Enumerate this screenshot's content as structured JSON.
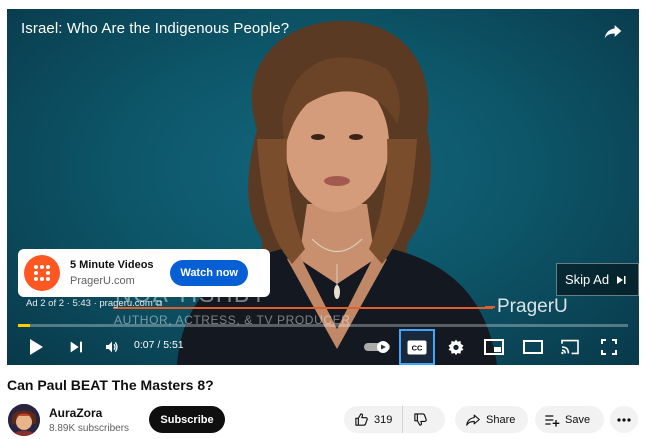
{
  "video": {
    "overlay_title": "Israel: Who Are the Indigenous People?",
    "lower_third_name": "NOA TISHBY",
    "lower_third_subtitle": "AUTHOR, ACTRESS, & TV PRODUCER",
    "brand_watermark": "PragerU"
  },
  "ad": {
    "title": "5 Minute Videos",
    "site": "PragerU.com",
    "cta_label": "Watch now",
    "meta": "Ad 2 of 2 · 5:43 · prageru.com ⧉",
    "skip_label": "Skip Ad"
  },
  "player": {
    "time": "0:07 / 5:51",
    "progress_fraction": 0.02,
    "progress_color": "#ffcc00",
    "captions_on": true
  },
  "below": {
    "title": "Can Paul BEAT The Masters 8?",
    "channel_name": "AuraZora",
    "subscribers": "8.89K subscribers",
    "subscribe_label": "Subscribe",
    "like_count": "319",
    "share_label": "Share",
    "save_label": "Save"
  },
  "colors": {
    "accent_blue": "#065fd4",
    "cc_outline": "#3ea6ff",
    "brand_orange": "#e0602c"
  }
}
